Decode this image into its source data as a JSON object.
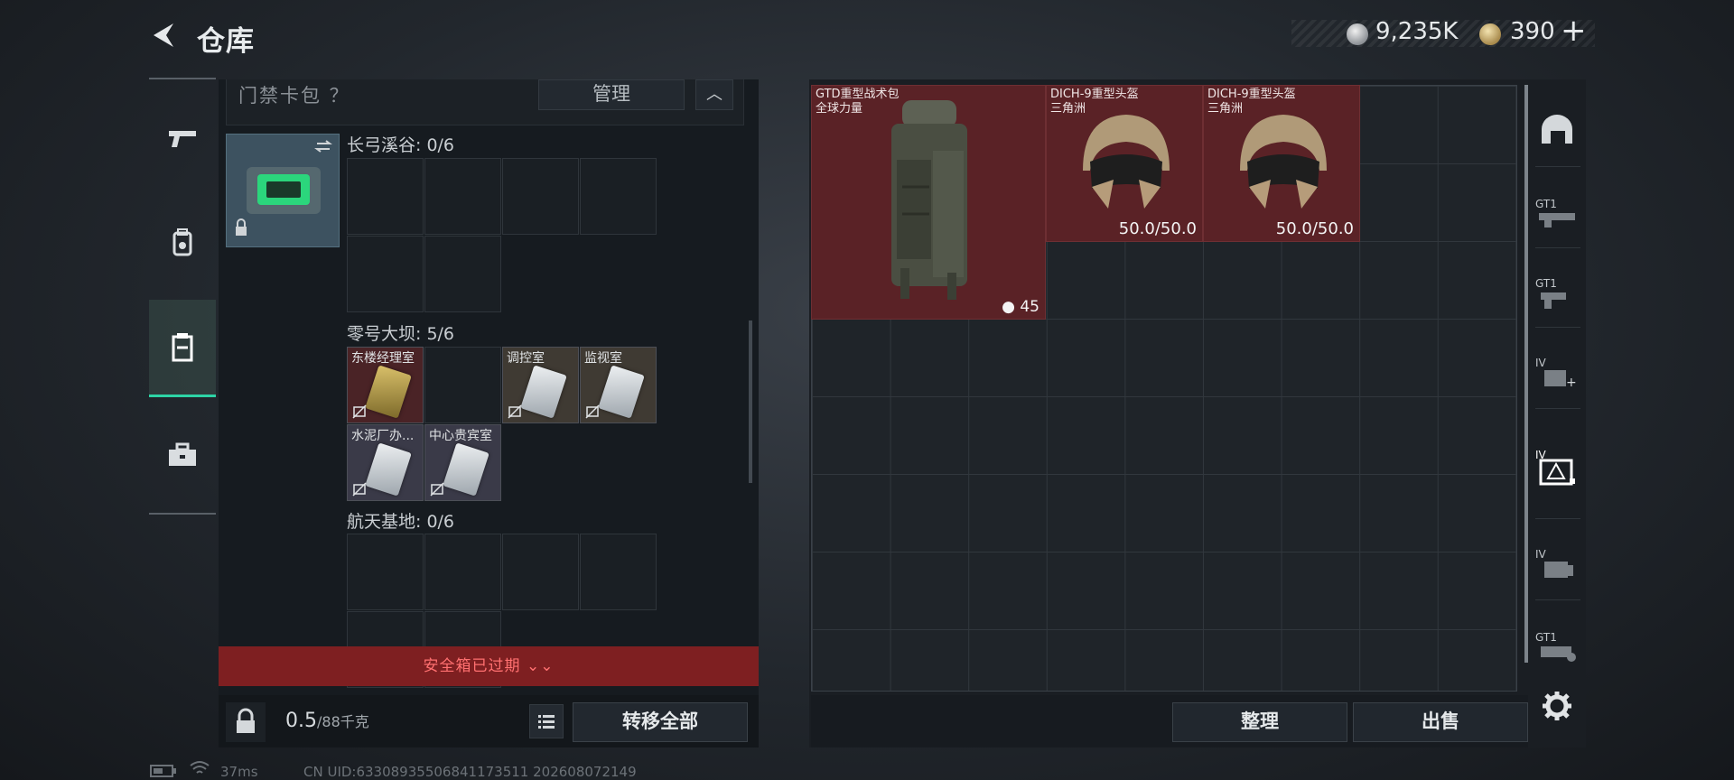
{
  "header": {
    "title": "仓库",
    "currency": {
      "silver": "9,235K",
      "gold": "390"
    },
    "plus": "+"
  },
  "sidebar": {
    "items": [
      {
        "name": "weapons",
        "icon": "gun-icon"
      },
      {
        "name": "equipment",
        "icon": "backpack-icon"
      },
      {
        "name": "containers",
        "icon": "container-icon",
        "active": true
      },
      {
        "name": "toolbox",
        "icon": "toolbox-icon"
      }
    ]
  },
  "left_panel": {
    "card_header": "门禁卡包 ？",
    "manage_label": "管理",
    "sections": [
      {
        "title": "长弓溪谷: 0/6"
      },
      {
        "title": "零号大坝: 5/6",
        "cards": [
          {
            "label": "东楼经理室",
            "color": "#b59b44"
          },
          {
            "label": "",
            "color": ""
          },
          {
            "label": "调控室",
            "color": "#c8ccd0"
          },
          {
            "label": "监视室",
            "color": "#c8ccd0"
          },
          {
            "label": "水泥厂办...",
            "color": "#c8ccd0"
          },
          {
            "label": "中心贵宾室",
            "color": "#c8ccd0"
          }
        ]
      },
      {
        "title": "航天基地: 0/6"
      }
    ],
    "expired_text": "安全箱已过期",
    "weight_value": "0.5",
    "weight_max": "/88千克",
    "transfer_label": "转移全部"
  },
  "right_panel": {
    "items": [
      {
        "name_line1": "GTD重型战术包",
        "name_line2": "全球力量",
        "capacity": "45"
      },
      {
        "name_line1": "DICH-9重型头盔",
        "name_line2": "三角洲",
        "durability": "50.0/50.0"
      },
      {
        "name_line1": "DICH-9重型头盔",
        "name_line2": "三角洲",
        "durability": "50.0/50.0"
      }
    ],
    "organize_label": "整理",
    "sell_label": "出售"
  },
  "side_icons": [
    "helmet-slot-icon",
    "gt1-weapon-icon",
    "gt1-pistol-icon",
    "iv-armor-icon",
    "iv-backpack-icon",
    "iv-container-icon",
    "gt1-misc-icon",
    "settings-icon"
  ],
  "status_bar": {
    "ping": "37ms",
    "uid": "CN UID:63308935506841173511 202608072149"
  },
  "colors": {
    "accent": "#2dd4a6",
    "item_bg": "#5a2226",
    "expired_bg": "#7e1f21"
  }
}
